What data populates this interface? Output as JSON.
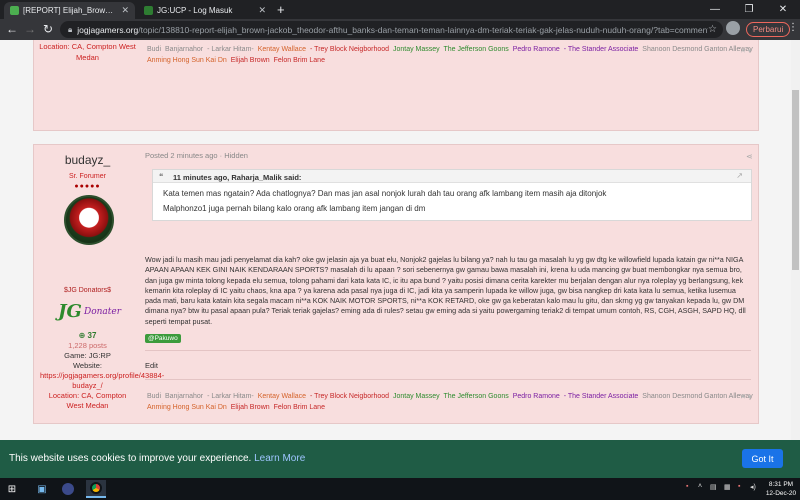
{
  "browser": {
    "tabs": [
      {
        "title": "[REPORT] Elijah_Brown, Jackob_Th...",
        "active": true,
        "favicon_color": "#4caf50"
      },
      {
        "title": "JG:UCP - Log Masuk",
        "active": false,
        "favicon_color": "#2e7d32"
      }
    ],
    "url_host": "jogjagamers.org",
    "url_path": "/topic/138810-report-elijah_brown-jackob_theodor-afthu_banks-dan-teman-teman-lainnya-dm-teriak-teriak-gak-jelas-nuduh-nuduh-orang/?tab=comments#comm...",
    "update_button": "Perbarui"
  },
  "post_prev": {
    "location": "Location: CA, Compton West Medan",
    "signature": [
      {
        "text": "Budi",
        "color": "#8a8a8a"
      },
      {
        "text": "Banjarnahor",
        "color": "#8a8a8a"
      },
      {
        "text": "- Larkar Hitam-",
        "color": "#8a8a8a"
      },
      {
        "text": "Kentay Wallace",
        "color": "#d4622a"
      },
      {
        "text": "- Trey Block Neigborhood",
        "color": "#c62828"
      },
      {
        "text": "Jontay Massey",
        "color": "#2e8b2e"
      },
      {
        "text": "The Jefferson Goons",
        "color": "#2e8b2e"
      },
      {
        "text": "Pedro Ramone",
        "color": "#7b1fa2"
      },
      {
        "text": "- The Stander Associate",
        "color": "#7b1fa2"
      },
      {
        "text": "Shanoon Desmond Ganton Alleway",
        "color": "#8a8a8a"
      }
    ],
    "signature2": [
      {
        "text": "Anming Hong Sun Kai Dn",
        "color": "#d4622a"
      },
      {
        "text": "Elijah Brown",
        "color": "#c62828"
      },
      {
        "text": "Felon Brim Lane",
        "color": "#c62828"
      }
    ]
  },
  "post": {
    "author": "budayz_",
    "rank": "Sr. Forumer",
    "pips": "●●●●●",
    "donor_label": "$JG Donators$",
    "donor_logo_jg": "JG",
    "donor_logo_text": "Donater",
    "reputation": "37",
    "posts": "1,228 posts",
    "game": "Game: JG:RP",
    "website_label": "Website:",
    "website_url": "https://jogjagamers.org/profile/43884-budayz_/",
    "location": "Location: CA, Compton West Medan",
    "posted": "Posted 2 minutes ago · Hidden",
    "quote_header_time": "11 minutes ago,",
    "quote_header_user": "Raharja_Malik said:",
    "quote_lines": [
      "Kata temen mas ngatain? Ada chatlognya? Dan mas jan asal nonjok lurah dah tau orang afk lambang item masih aja ditonjok",
      "Malphonzo1 juga pernah bilang kalo orang afk lambang item jangan di dm"
    ],
    "body": "Wow jadi lu masih mau jadi penyelamat dia kah? oke gw jelasin aja ya buat elu, Nonjok2 gajelas lu bilang ya? nah lu tau ga masalah lu yg gw dtg ke willowfield lupada katain gw ni**a NIGA APAAN APAAN KEK GINI NAIK KENDARAAN SPORTS? masalah di lu apaan ? sori sebenernya gw gamau bawa masalah ini, krena lu uda mancing gw buat membongkar nya semua bro,  dan juga gw minta tolong kepada elu semua, tolong pahami dari kata kata IC, ic itu apa bund ? yaitu posisi dimana cerita karekter mu berjalan dengan alur nya  roleplay yg berlangsung, kek kemarin kita roleplay di IC yaitu chaos, kna apa ? ya karena ada pasal nya juga di IC, jadi kita ya samperin lupada ke willow juga, gw bisa nangkep dri kata kata lu semua, ketika lusemua pada mati, baru kata katain kita segala macam ni**a KOK NAIK MOTOR SPORTS, ni**a KOK RETARD, oke gw ga keberatan kalo mau lu gitu, dan skrng yg gw tanyakan kepada lu, gw DM dimana nya? btw itu pasal apaan pula? Teriak teriak gajelas? eming ada di rules? setau gw eming ada si yaitu powergaming teriak2 di tempat umum contoh, RS, CGH, ASGH, SAPD HQ, dll seperti tempat pusat.",
    "mention": "@Pakuwo",
    "edit": "Edit"
  },
  "cookie": {
    "message": "This website uses cookies to improve your experience.",
    "link": "Learn More",
    "button": "Got It"
  },
  "clock": {
    "time": "8:31 PM",
    "date": "12-Dec-20"
  }
}
